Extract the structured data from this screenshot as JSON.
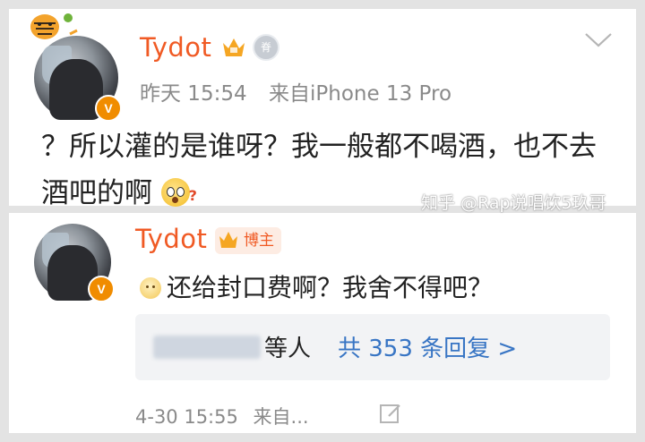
{
  "post": {
    "username": "Tydot",
    "medal_char": "脊",
    "time": "昨天 15:54",
    "source": "来自iPhone 13 Pro",
    "text": "？所以灌的是谁呀？我一般都不喝酒，也不去酒吧的啊",
    "emoji": "surprised-emoji",
    "badge_v": "V"
  },
  "reply": {
    "username": "Tydot",
    "blogger_tag": "博主",
    "text": "还给封口费啊？我舍不得吧？",
    "emoji": "sad-emoji",
    "others_label": "等人",
    "reply_count_text": "共 353 条回复 >",
    "time": "4-30 15:55",
    "source": "来自...",
    "badge_v": "V"
  },
  "watermark": "知乎 @Rap说唱饮5玖哥",
  "colors": {
    "username": "#f05a24",
    "link": "#3875c4",
    "meta": "#8a8a8a",
    "badge": "#f08c00"
  }
}
